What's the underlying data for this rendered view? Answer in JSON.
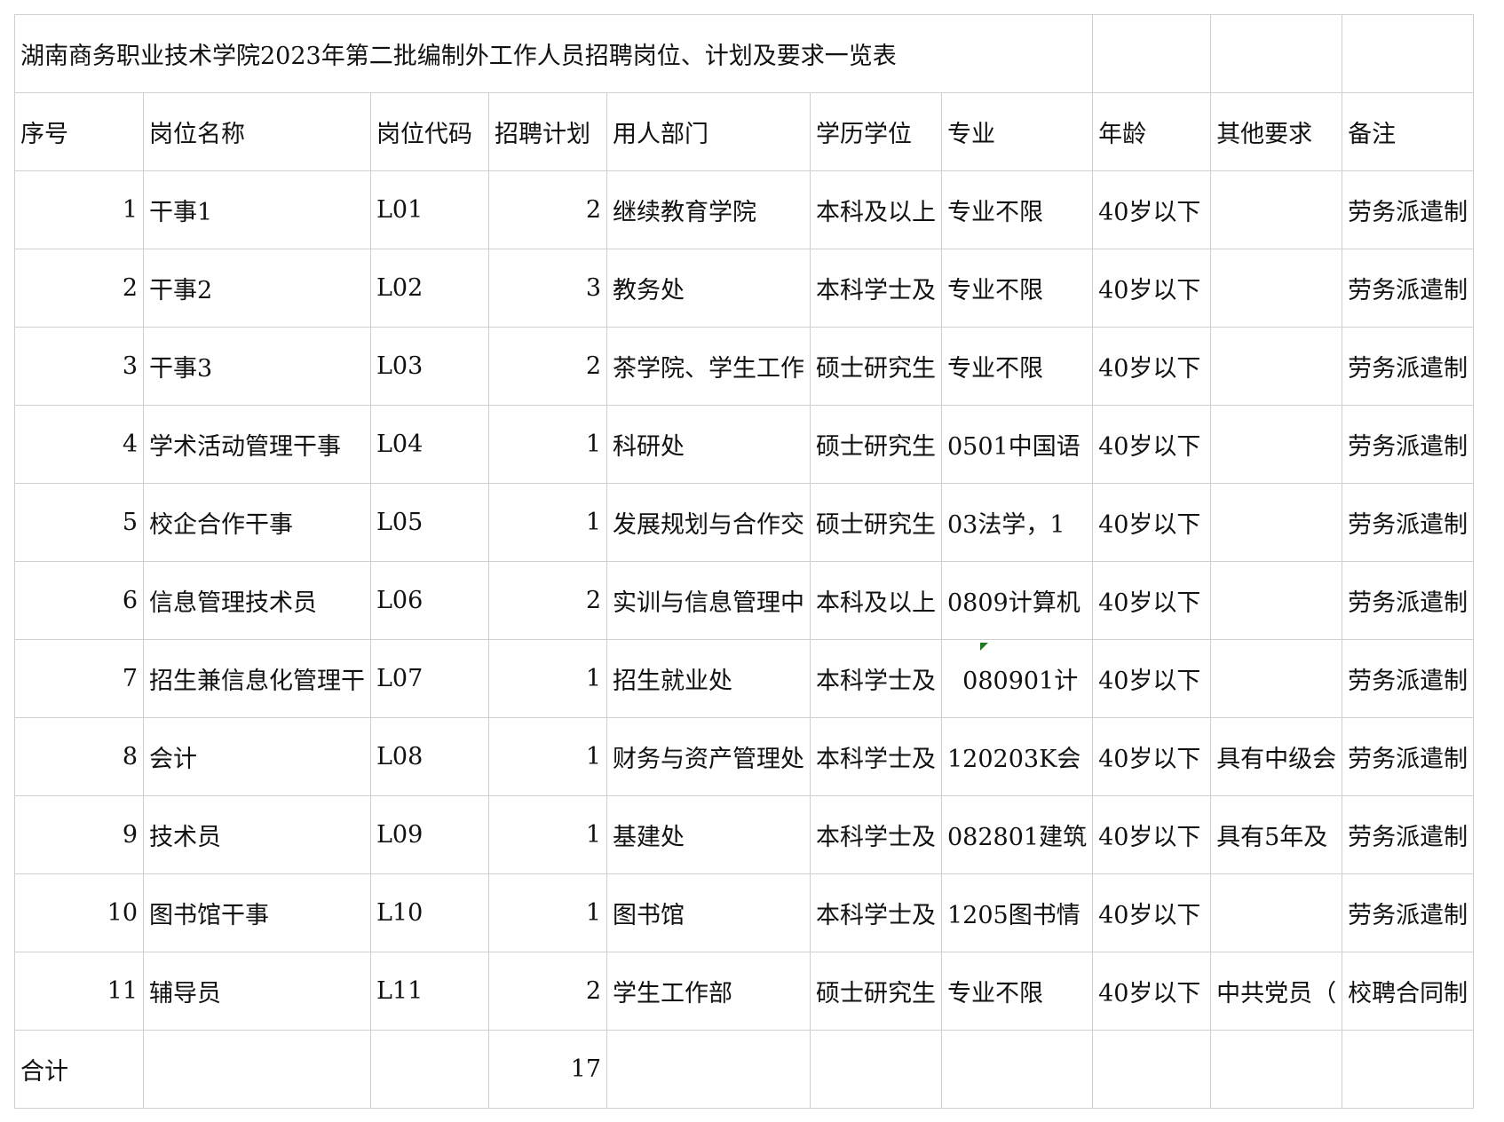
{
  "title": "湖南商务职业技术学院2023年第二批编制外工作人员招聘岗位、计划及要求一览表",
  "headers": [
    "序号",
    "岗位名称",
    "岗位代码",
    "招聘计划",
    "用人部门",
    "学历学位",
    "专业",
    "年龄",
    "其他要求",
    "备注"
  ],
  "rows": [
    [
      "1",
      "干事1",
      "L01",
      "2",
      "继续教育学院",
      "本科及以上",
      "专业不限",
      "40岁以下",
      "",
      "劳务派遣制"
    ],
    [
      "2",
      "干事2",
      "L02",
      "3",
      "教务处",
      "本科学士及",
      "专业不限",
      "40岁以下",
      "",
      "劳务派遣制"
    ],
    [
      "3",
      "干事3",
      "L03",
      "2",
      "茶学院、学生工作",
      "硕士研究生",
      "专业不限",
      "40岁以下",
      "",
      "劳务派遣制"
    ],
    [
      "4",
      "学术活动管理干事",
      "L04",
      "1",
      "科研处",
      "硕士研究生",
      "0501中国语",
      "40岁以下",
      "",
      "劳务派遣制"
    ],
    [
      "5",
      "校企合作干事",
      "L05",
      "1",
      "发展规划与合作交",
      "硕士研究生",
      "03法学，1",
      "40岁以下",
      "",
      "劳务派遣制"
    ],
    [
      "6",
      "信息管理技术员",
      "L06",
      "2",
      "实训与信息管理中",
      "本科及以上",
      "0809计算机",
      "40岁以下",
      "",
      "劳务派遣制"
    ],
    [
      "7",
      "招生兼信息化管理干",
      "L07",
      "1",
      "招生就业处",
      "本科学士及",
      "  080901计",
      "40岁以下",
      "",
      "劳务派遣制"
    ],
    [
      "8",
      "会计",
      "L08",
      "1",
      "财务与资产管理处",
      "本科学士及",
      "120203K会",
      "40岁以下",
      "具有中级会",
      "劳务派遣制"
    ],
    [
      "9",
      "技术员",
      "L09",
      "1",
      "基建处",
      "本科学士及",
      "082801建筑",
      "40岁以下",
      "具有5年及",
      "劳务派遣制"
    ],
    [
      "10",
      "图书馆干事",
      "L10",
      "1",
      "图书馆",
      "本科学士及",
      "1205图书情",
      "40岁以下",
      "",
      "劳务派遣制"
    ],
    [
      "11",
      "辅导员",
      "L11",
      "2",
      "学生工作部",
      "硕士研究生",
      "专业不限",
      "40岁以下",
      "中共党员（",
      "校聘合同制"
    ]
  ],
  "total": {
    "label": "合计",
    "plan": "17"
  }
}
